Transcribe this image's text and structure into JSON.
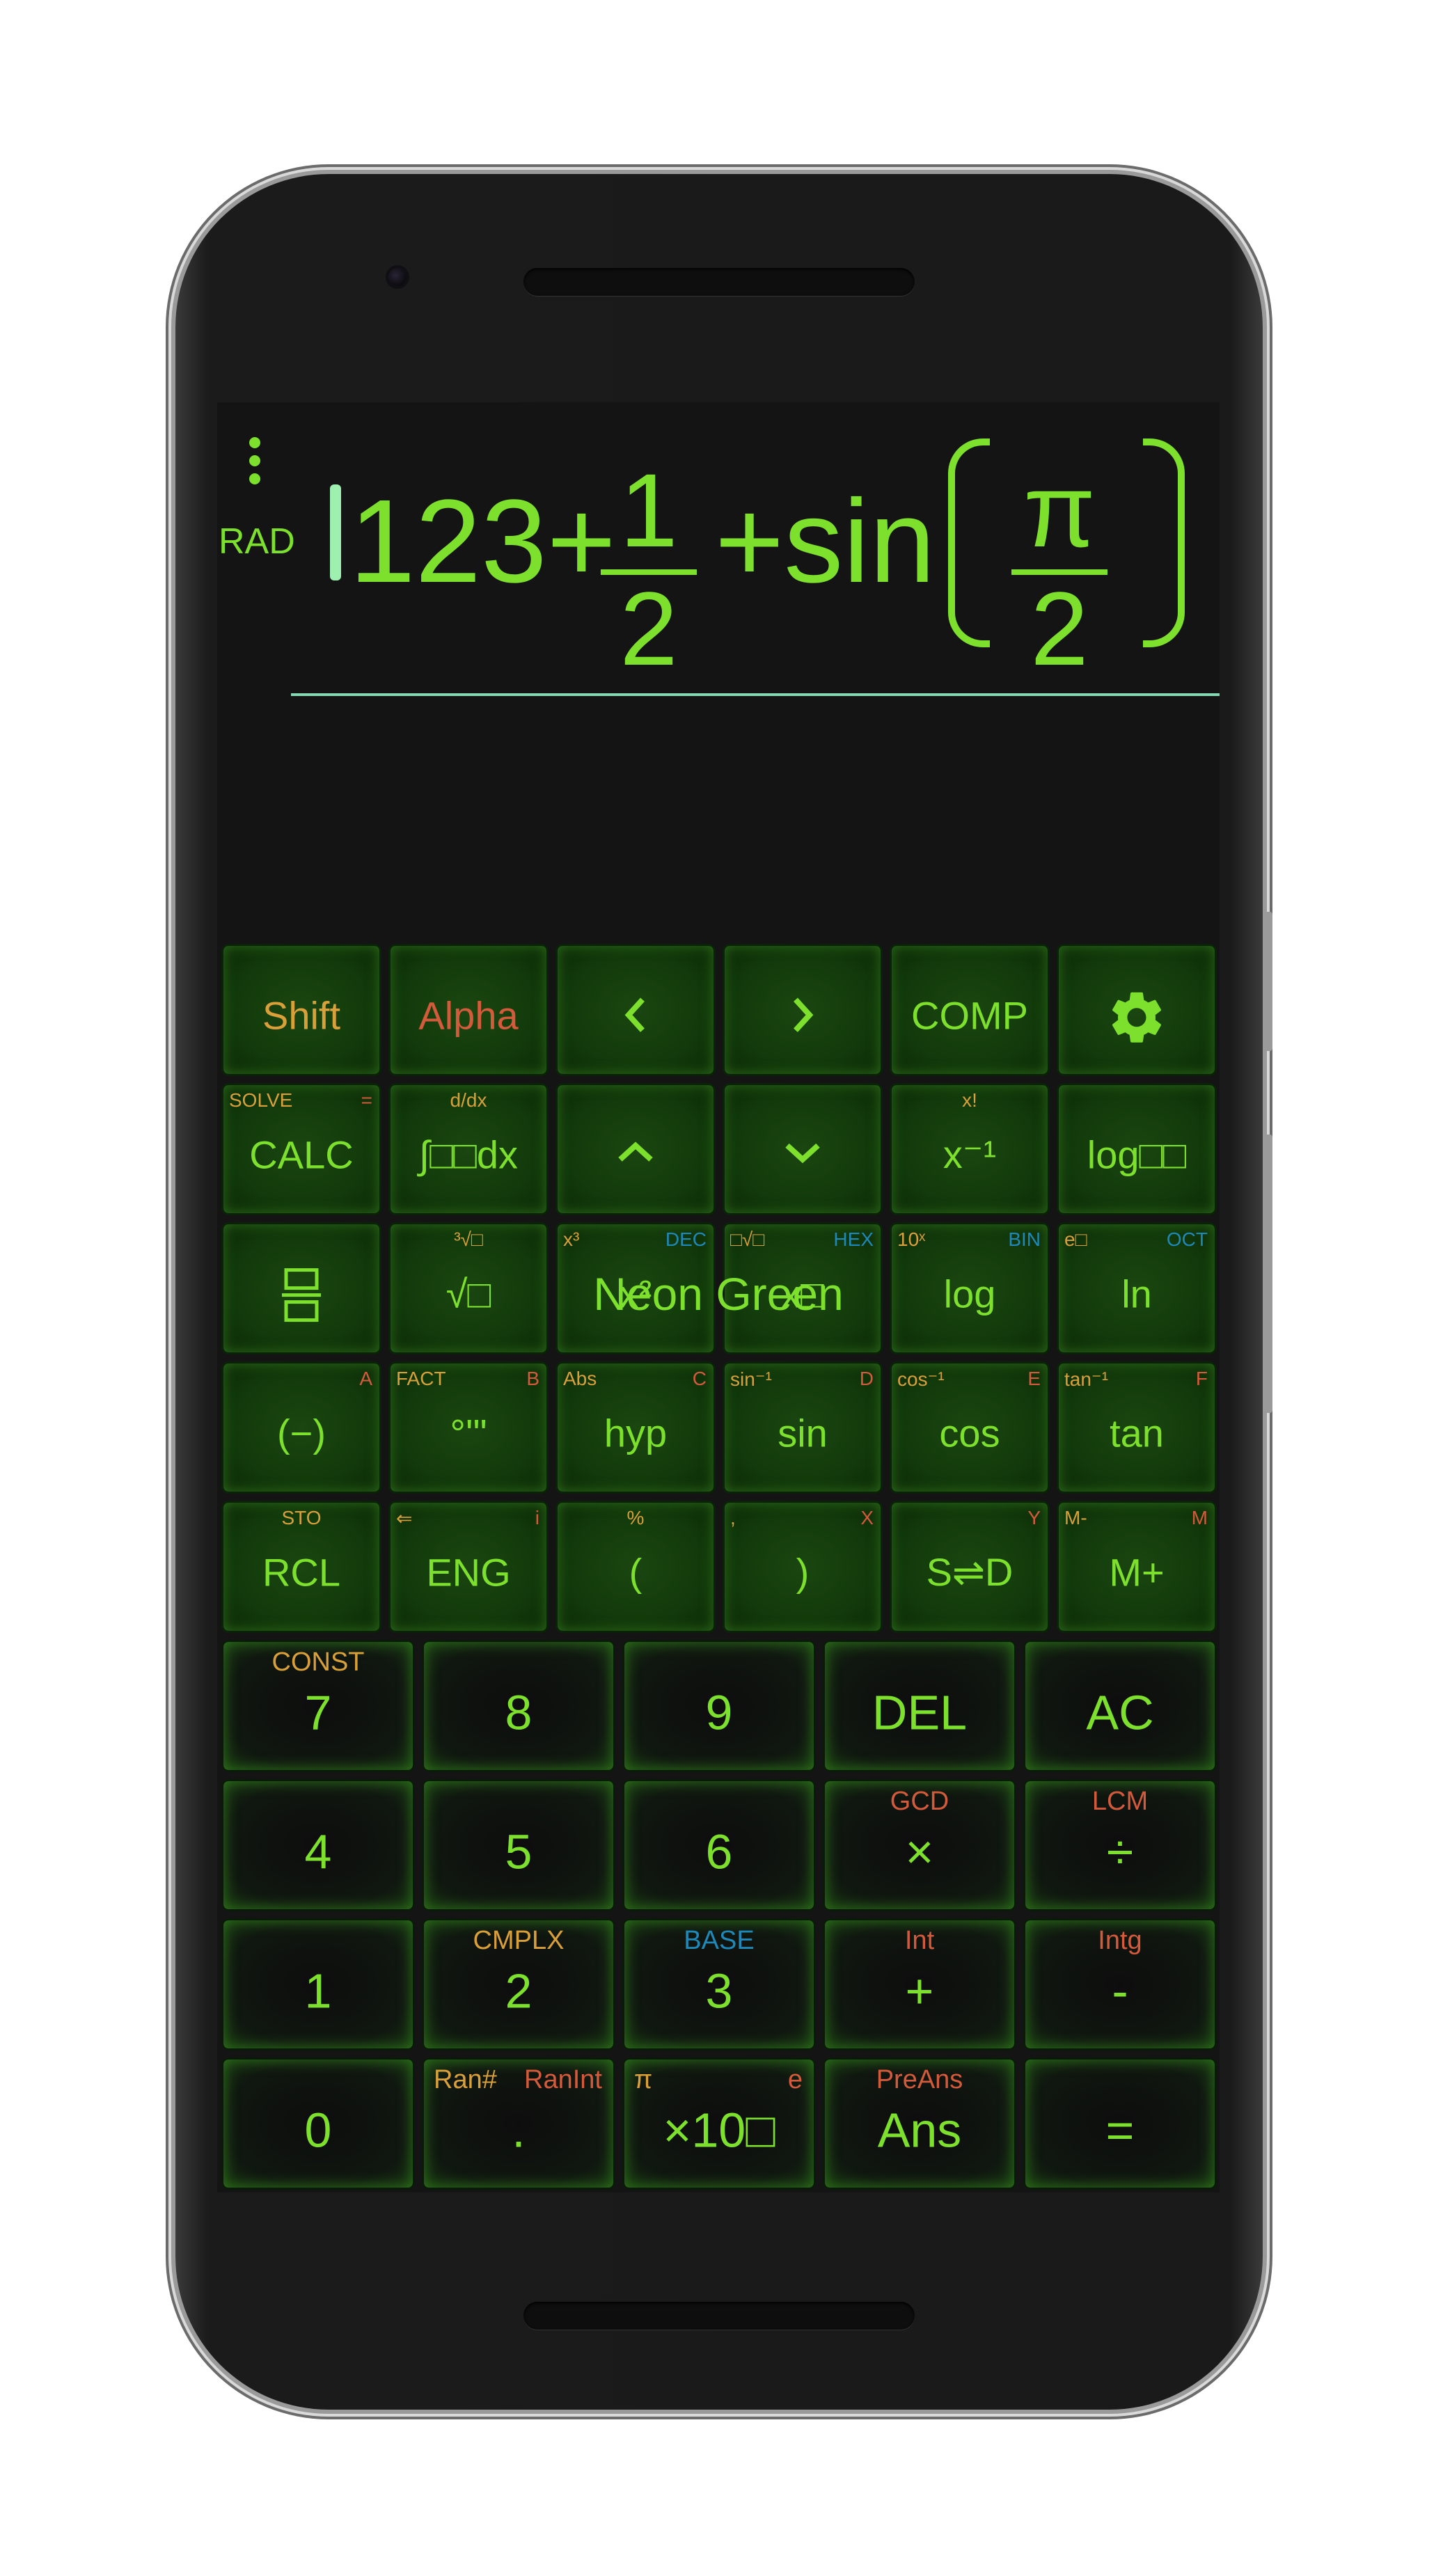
{
  "display": {
    "mode": "RAD",
    "expression": {
      "part1": "123+",
      "frac1_num": "1",
      "frac1_den": "2",
      "part2": "+sin",
      "frac2_num": "π",
      "frac2_den": "2"
    }
  },
  "toast": "Neon Green",
  "colors": {
    "accent": "#7de02c",
    "shift": "#d9a03a",
    "alpha": "#d35a3a",
    "base": "#1e88b8"
  },
  "keys": {
    "r1": {
      "shift": "Shift",
      "alpha": "Alpha",
      "left": "<",
      "right": ">",
      "comp": "COMP",
      "settings_icon": "gear-icon"
    },
    "r2": {
      "calc": {
        "main": "CALC",
        "tl": "SOLVE",
        "tr": "="
      },
      "integral": {
        "main": "∫□□dx",
        "tc": "d/dx"
      },
      "up": "^",
      "down": "⌄",
      "inverse": {
        "main": "x⁻¹",
        "tc": "x!"
      },
      "logbase": {
        "main": "log□□"
      }
    },
    "r3": {
      "fraction_icon": "fraction-icon",
      "sqrt": {
        "main": "√□",
        "tc": "³√□"
      },
      "square": {
        "main": "x²",
        "tl": "x³",
        "tr": "DEC"
      },
      "power": {
        "main": "x□",
        "tl": "□√□",
        "tr": "HEX"
      },
      "log": {
        "main": "log",
        "tl": "10ˣ",
        "tr": "BIN"
      },
      "ln": {
        "main": "ln",
        "tl": "e□",
        "tr": "OCT"
      }
    },
    "r4": {
      "neg": {
        "main": "(−)",
        "tr": "A"
      },
      "deg": {
        "main": "°'\"",
        "tl": "FACT",
        "tr": "B"
      },
      "hyp": {
        "main": "hyp",
        "tl": "Abs",
        "tr": "C"
      },
      "sin": {
        "main": "sin",
        "tl": "sin⁻¹",
        "tr": "D"
      },
      "cos": {
        "main": "cos",
        "tl": "cos⁻¹",
        "tr": "E"
      },
      "tan": {
        "main": "tan",
        "tl": "tan⁻¹",
        "tr": "F"
      }
    },
    "r5": {
      "rcl": {
        "main": "RCL",
        "tc": "STO"
      },
      "eng": {
        "main": "ENG",
        "tl": "⇐",
        "tr": "i"
      },
      "lparen": {
        "main": "(",
        "tc": "%"
      },
      "rparen": {
        "main": ")",
        "tl": ",",
        "tr": "X"
      },
      "sd": {
        "main": "S⇌D",
        "tr": "Y"
      },
      "mplus": {
        "main": "M+",
        "tl": "M-",
        "tr": "M"
      }
    },
    "r6": {
      "k7": {
        "main": "7",
        "tc": "CONST"
      },
      "k8": {
        "main": "8"
      },
      "k9": {
        "main": "9"
      },
      "del": {
        "main": "DEL"
      },
      "ac": {
        "main": "AC"
      }
    },
    "r7": {
      "k4": {
        "main": "4"
      },
      "k5": {
        "main": "5"
      },
      "k6": {
        "main": "6"
      },
      "mul": {
        "main": "×",
        "tc": "GCD"
      },
      "div": {
        "main": "÷",
        "tc": "LCM"
      }
    },
    "r8": {
      "k1": {
        "main": "1"
      },
      "k2": {
        "main": "2",
        "tc": "CMPLX"
      },
      "k3": {
        "main": "3",
        "tc": "BASE"
      },
      "add": {
        "main": "+",
        "tc": "Int"
      },
      "sub": {
        "main": "-",
        "tc": "Intg"
      }
    },
    "r9": {
      "k0": {
        "main": "0"
      },
      "dot": {
        "main": ".",
        "tl": "Ran#",
        "tr": "RanInt"
      },
      "exp": {
        "main": "×10□",
        "tl": "π",
        "tr": "e"
      },
      "ans": {
        "main": "Ans",
        "tc": "PreAns"
      },
      "eq": {
        "main": "="
      }
    }
  }
}
